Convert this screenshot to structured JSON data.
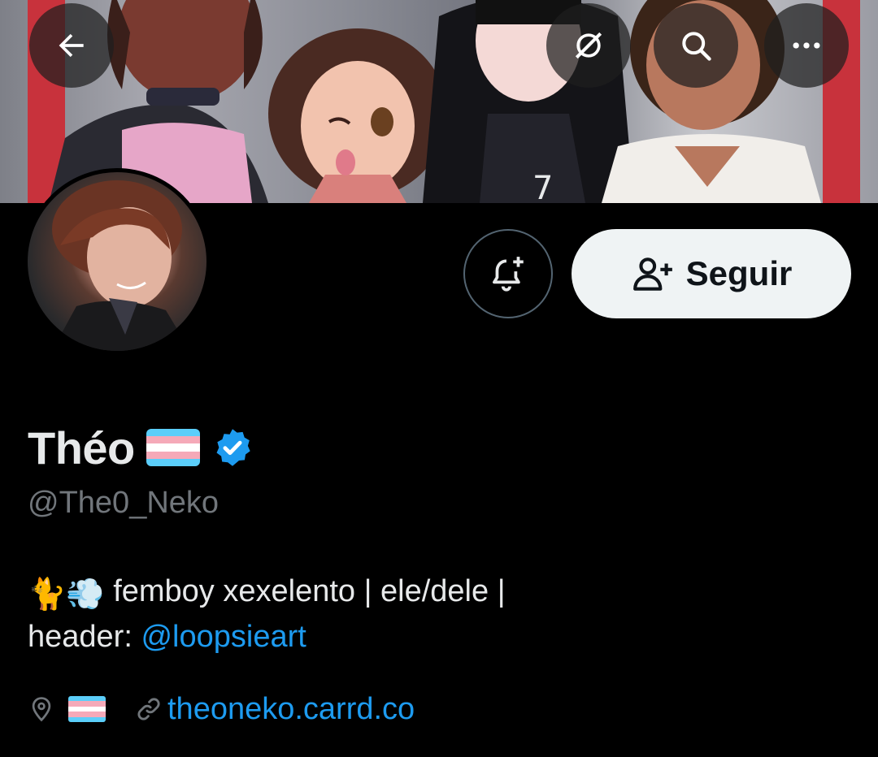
{
  "banner": {
    "credit_description": "illustrated header"
  },
  "top_bar": {
    "back_icon": "arrow-left-icon",
    "grok_icon": "grok-icon",
    "search_icon": "search-icon",
    "more_icon": "more-horizontal-icon"
  },
  "actions": {
    "notify_icon": "bell-plus-icon",
    "follow_label": "Seguir",
    "follow_icon": "person-add-icon"
  },
  "profile": {
    "display_name": "Théo",
    "handle": "@The0_Neko",
    "verified_color": "#1d9bf0",
    "bio_line1_emoji": "🐈💨",
    "bio_line1_text": " femboy xexelento | ele/dele |",
    "bio_line2_prefix": "header: ",
    "bio_mention": "@loopsieart",
    "location_icon": "location-pin-icon",
    "link_icon": "link-icon",
    "link_text": "theoneko.carrd.co"
  },
  "colors": {
    "accent": "#1d9bf0",
    "trans_blue": "#5bcefa",
    "trans_pink": "#f5a9b8",
    "trans_white": "#ffffff"
  }
}
